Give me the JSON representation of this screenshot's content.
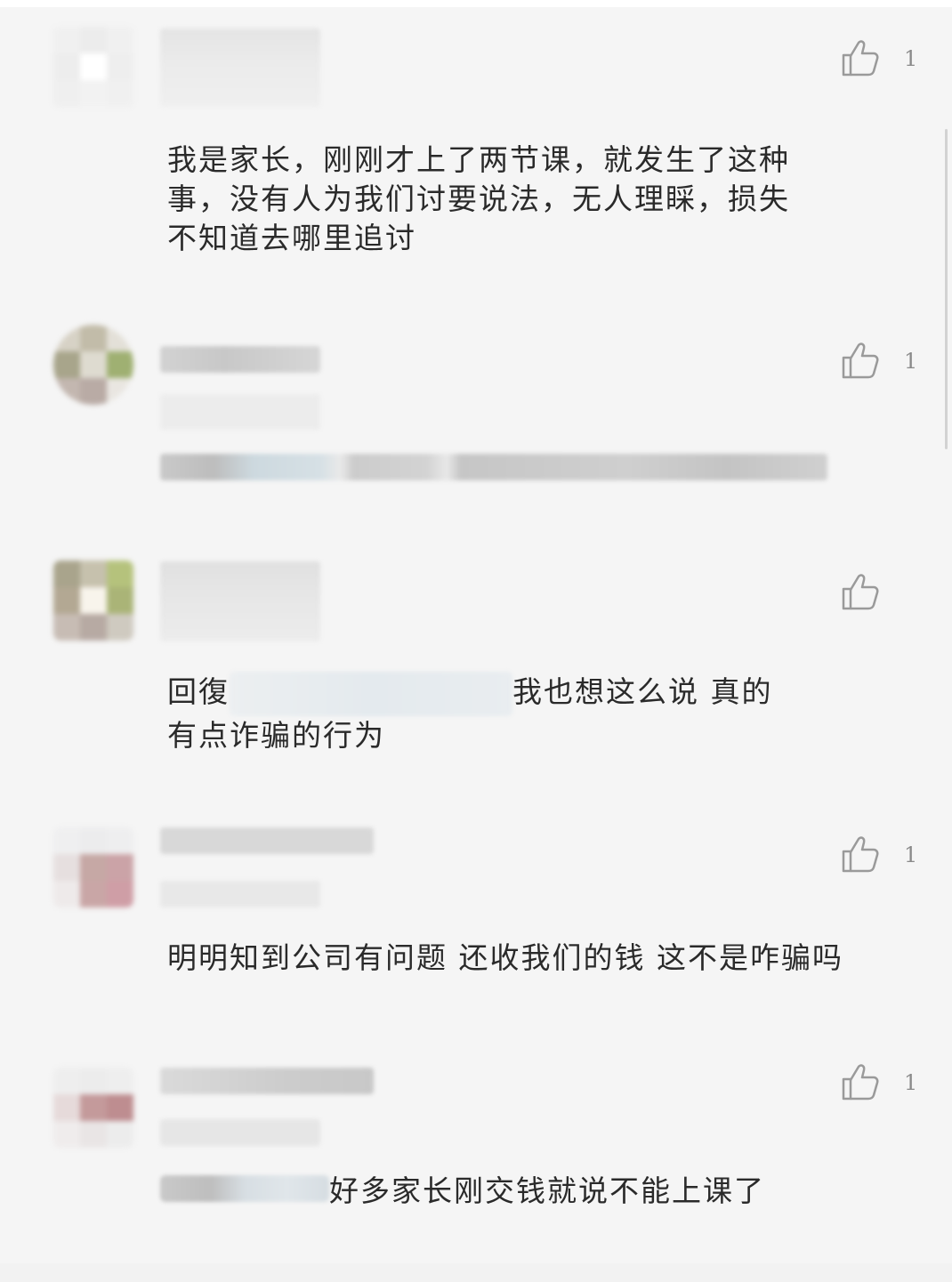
{
  "comments": [
    {
      "likes": "1",
      "text_lines": [
        "我是家长，刚刚才上了两节课，就发生了这种",
        "事，没有人为我们讨要说法，无人理睬，损失",
        "不知道去哪里追讨"
      ]
    },
    {
      "likes": "1"
    },
    {
      "reply_prefix": "回復",
      "text_line1_suffix": "我也想这么说 真的",
      "text_line2": "有点诈骗的行为"
    },
    {
      "likes": "1",
      "text": "明明知到公司有问题 还收我们的钱 这不是咋骗吗"
    },
    {
      "likes": "1",
      "text_suffix": "好多家长刚交钱就说不能上课了"
    }
  ],
  "icons": {
    "like": "thumbs-up-icon"
  },
  "colors": {
    "background": "#f5f5f5",
    "text": "#2a2a2a",
    "like_icon": "#9a9a9a"
  }
}
